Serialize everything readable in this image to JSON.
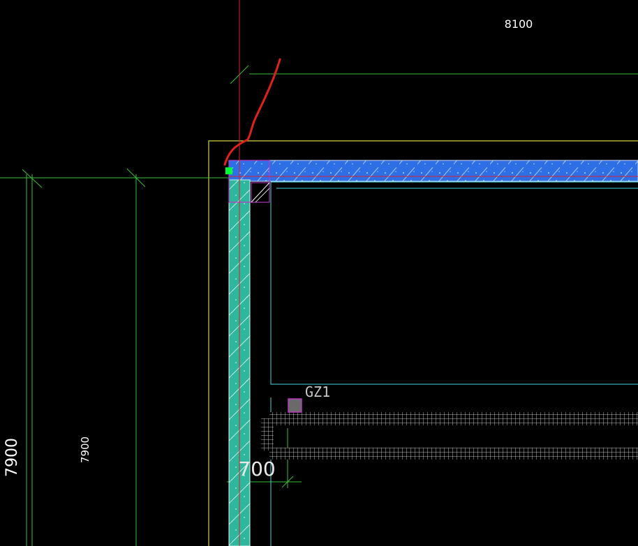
{
  "drawing": {
    "dims": {
      "top": "8100",
      "left_outer": "7900",
      "left_inner": "7900",
      "wall_width": "700"
    },
    "labels": {
      "column": "GZ1"
    }
  },
  "colors": {
    "background": "#000000",
    "grid_line": "#39c03a",
    "axis_red": "#d8202a",
    "boundary_yellow": "#d8d24a",
    "beam_blue": "#2f6fe6",
    "wall_teal": "#2fb79d",
    "cyan_outline": "#44d6e0",
    "magenta": "#c236c8",
    "white": "#ffffff",
    "grip_green": "#00ff33",
    "annotation_red": "#e0201a"
  }
}
